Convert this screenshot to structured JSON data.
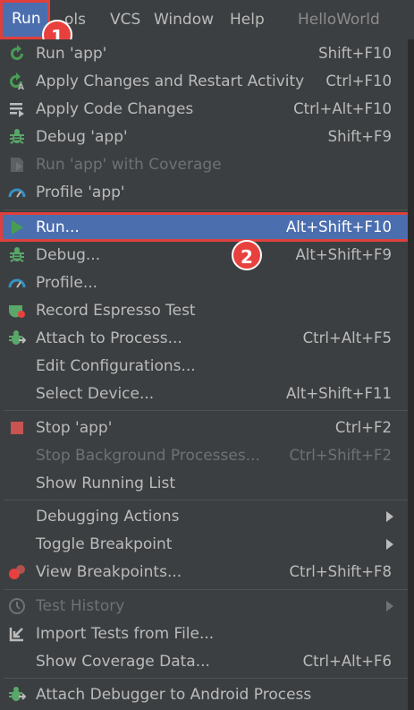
{
  "menubar": {
    "run": "Run",
    "tools": "ols",
    "vcs": "VCS",
    "window": "Window",
    "help": "Help",
    "project": "HelloWorld"
  },
  "badges": {
    "first": "1",
    "second": "2"
  },
  "menu": {
    "run_app": {
      "label": "Run 'app'",
      "shortcut": "Shift+F10"
    },
    "apply_changes_restart": {
      "label": "Apply Changes and Restart Activity",
      "shortcut": "Ctrl+F10"
    },
    "apply_code_changes": {
      "label": "Apply Code Changes",
      "shortcut": "Ctrl+Alt+F10"
    },
    "debug_app": {
      "label": "Debug 'app'",
      "shortcut": "Shift+F9"
    },
    "run_with_coverage": {
      "label": "Run 'app' with Coverage",
      "shortcut": ""
    },
    "profile_app": {
      "label": "Profile 'app'",
      "shortcut": ""
    },
    "run_dots": {
      "label": "Run...",
      "shortcut": "Alt+Shift+F10"
    },
    "debug_dots": {
      "label": "Debug...",
      "shortcut": "Alt+Shift+F9"
    },
    "profile_dots": {
      "label": "Profile...",
      "shortcut": ""
    },
    "record_espresso": {
      "label": "Record Espresso Test",
      "shortcut": ""
    },
    "attach_process": {
      "label": "Attach to Process...",
      "shortcut": "Ctrl+Alt+F5"
    },
    "edit_configurations": {
      "label": "Edit Configurations...",
      "shortcut": ""
    },
    "select_device": {
      "label": "Select Device...",
      "shortcut": "Alt+Shift+F11"
    },
    "stop_app": {
      "label": "Stop 'app'",
      "shortcut": "Ctrl+F2"
    },
    "stop_background": {
      "label": "Stop Background Processes...",
      "shortcut": "Ctrl+Shift+F2"
    },
    "show_running_list": {
      "label": "Show Running List",
      "shortcut": ""
    },
    "debugging_actions": {
      "label": "Debugging Actions",
      "shortcut": ""
    },
    "toggle_breakpoint": {
      "label": "Toggle Breakpoint",
      "shortcut": ""
    },
    "view_breakpoints": {
      "label": "View Breakpoints...",
      "shortcut": "Ctrl+Shift+F8"
    },
    "test_history": {
      "label": "Test History",
      "shortcut": ""
    },
    "import_tests": {
      "label": "Import Tests from File...",
      "shortcut": ""
    },
    "show_coverage": {
      "label": "Show Coverage Data...",
      "shortcut": "Ctrl+Alt+F6"
    },
    "attach_debugger": {
      "label": "Attach Debugger to Android Process",
      "shortcut": ""
    }
  },
  "colors": {
    "menu_bg": "#3c3f41",
    "selection": "#4b6eaf",
    "highlight_border": "#e0403c",
    "run_green": "#499c54",
    "debug_green": "#59a869"
  }
}
